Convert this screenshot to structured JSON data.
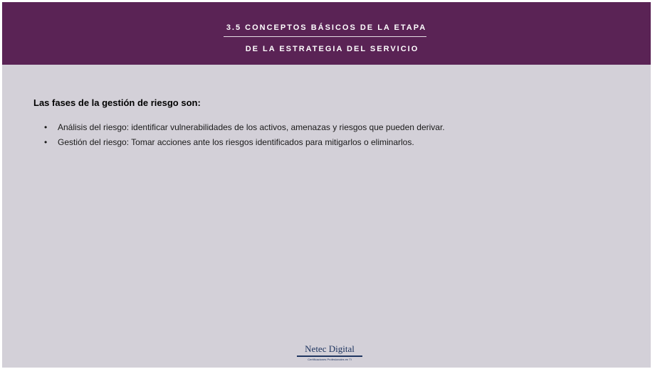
{
  "header": {
    "line1": "3.5 CONCEPTOS BÁSICOS DE LA ETAPA",
    "line2": "DE LA ESTRATEGIA DEL SERVICIO",
    "background_color": "#5a2355",
    "text_color": "#ffffff"
  },
  "content": {
    "heading": "Las fases de la gestión de riesgo son:",
    "bullet_glyph": "•",
    "items": [
      "Análisis del riesgo: identificar vulnerabilidades de los activos, amenazas y riesgos que pueden derivar.",
      "Gestión del riesgo: Tomar acciones ante los riesgos identificados para mitigarlos o eliminarlos."
    ]
  },
  "footer": {
    "logo_name": "Netec Digital",
    "logo_tagline": "Certificaciones Profesionales en TI",
    "logo_color": "#1f3560"
  },
  "page_background": "#d3d0d8"
}
